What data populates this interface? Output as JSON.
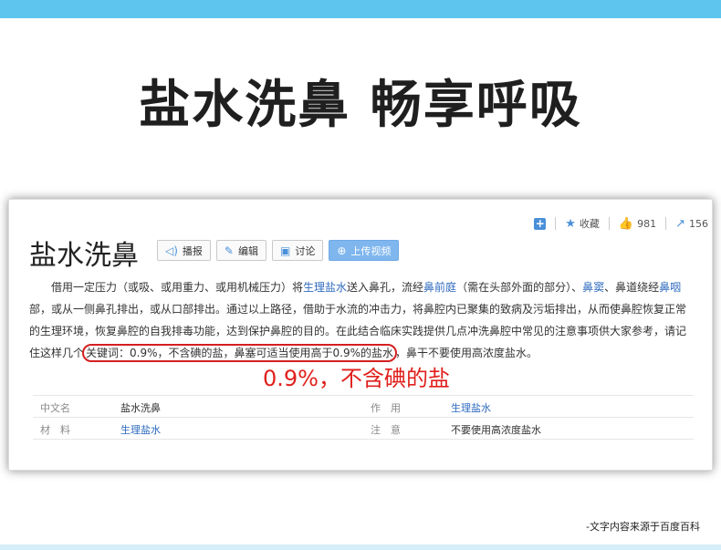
{
  "headline": "盐水洗鼻 畅享呼吸",
  "card": {
    "title": "盐水洗鼻",
    "toolbar": {
      "broadcast": "播报",
      "edit": "编辑",
      "discuss": "讨论",
      "upload_video": "上传视频"
    },
    "stats": {
      "favorite_label": "收藏",
      "likes": "981",
      "shares": "156"
    },
    "paragraph": {
      "s1": "借用一定压力（或吸、或用重力、或用机械压力）将",
      "l1": "生理盐水",
      "s2": "送入鼻孔，流经",
      "l2": "鼻前庭",
      "s3": "（需在头部外面的部分）、",
      "l3": "鼻窦",
      "s4": "、鼻道绕经",
      "l4": "鼻咽",
      "s5": "部，或从一侧鼻孔排出，或从口部排出。通过以上路径，借助于水流的冲击力，将鼻腔内已聚集的致病及污垢排出，从而使鼻腔恢复正常的生理环境，恢复鼻腔的自我排毒功能，达到保护鼻腔的目的。在此结合临床实践提供几点冲洗鼻腔中常见的注意事项供大家参考，请记住这样几个",
      "highlight": "关键词：0.9%，不含碘的盐，鼻塞可适当使用高于0.9%的盐水",
      "s6": "，鼻干不要使用高浓度盐水。"
    },
    "annotation": "0.9%，不含碘的盐",
    "infobox": {
      "rows": [
        {
          "k1": "中文名",
          "v1": "盐水洗鼻",
          "k2": "作　用",
          "v2": "生理盐水"
        },
        {
          "k1": "材　料",
          "v1": "生理盐水",
          "k2": "注　意",
          "v2": "不要使用高浓度盐水"
        }
      ]
    }
  },
  "source": "-文字内容来源于百度百科",
  "colors": {
    "top_bar": "#5ec5ee",
    "link": "#2f6bbf",
    "highlight_red": "#d32020",
    "primary_button": "#7fb6ee"
  }
}
